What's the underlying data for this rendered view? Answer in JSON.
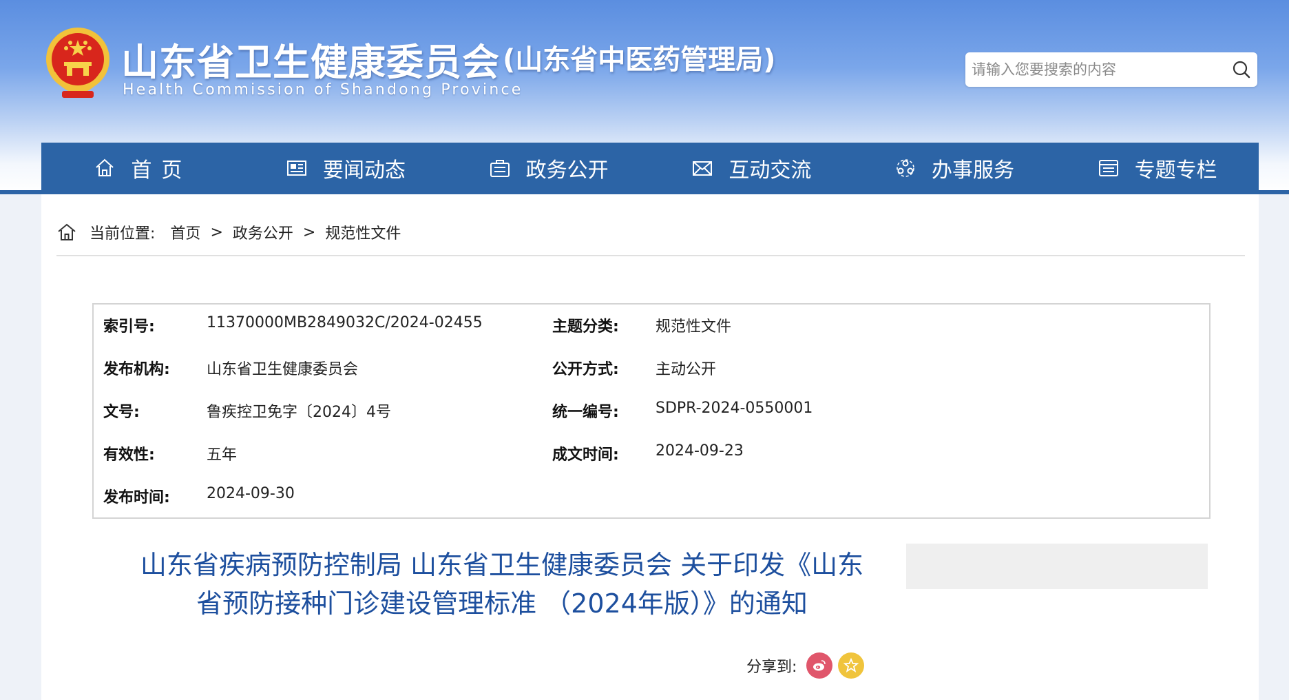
{
  "header": {
    "site_title": "山东省卫生健康委员会",
    "site_subtitle": "(山东省中医药管理局)",
    "site_title_en": "Health Commission  of  Shandong  Province",
    "emblem_icon": "national-emblem-icon",
    "search": {
      "placeholder": "请输入您要搜索的内容",
      "icon": "search-icon"
    }
  },
  "nav": {
    "items": [
      {
        "label": "首页",
        "icon": "home-icon"
      },
      {
        "label": "要闻动态",
        "icon": "newspaper-icon"
      },
      {
        "label": "政务公开",
        "icon": "briefcase-icon"
      },
      {
        "label": "互动交流",
        "icon": "mail-icon"
      },
      {
        "label": "办事服务",
        "icon": "people-icon"
      },
      {
        "label": "专题专栏",
        "icon": "list-icon"
      }
    ]
  },
  "breadcrumb": {
    "prefix": "当前位置:",
    "separator": ">",
    "items": [
      "首页",
      "政务公开",
      "规范性文件"
    ]
  },
  "meta": {
    "rows": [
      {
        "label": "索引号:",
        "value": "11370000MB2849032C/2024-02455",
        "label2": "主题分类:",
        "value2": "规范性文件"
      },
      {
        "label": "发布机构:",
        "value": "山东省卫生健康委员会",
        "label2": "公开方式:",
        "value2": "主动公开"
      },
      {
        "label": "文号:",
        "value": "鲁疾控卫免字〔2024〕4号",
        "label2": "统一编号:",
        "value2": "SDPR-2024-0550001"
      },
      {
        "label": "有效性:",
        "value": "五年",
        "label2": "成文时间:",
        "value2": "2024-09-23"
      },
      {
        "label": "发布时间:",
        "value": "2024-09-30",
        "label2": "",
        "value2": ""
      }
    ]
  },
  "document": {
    "title_line1": "山东省疾病预防控制局 山东省卫生健康委员会 关于印发《山东",
    "title_line2": "省预防接种门诊建设管理标准 （2024年版）》的通知"
  },
  "share": {
    "label": "分享到:",
    "buttons": [
      {
        "icon": "weibo-icon"
      },
      {
        "icon": "favorite-star-icon"
      }
    ]
  },
  "colors": {
    "nav_bg": "#2c64a6",
    "title_blue": "#1d4f9e",
    "header_top": "#5b8ee0"
  }
}
